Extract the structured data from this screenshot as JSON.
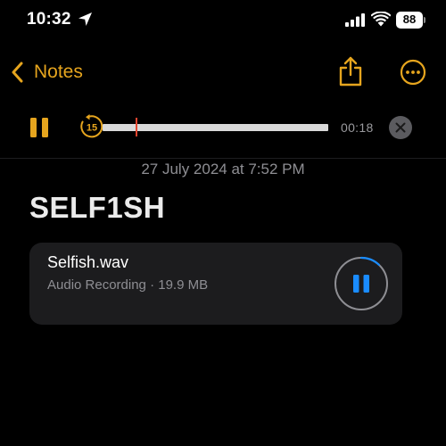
{
  "status_bar": {
    "time": "10:32",
    "battery": "88",
    "icons": [
      "location-arrow-icon",
      "cellular-signal-icon",
      "wifi-icon",
      "battery-icon"
    ]
  },
  "nav": {
    "back_label": "Notes",
    "icons": [
      "chevron-left-icon",
      "share-icon",
      "more-icon"
    ]
  },
  "player": {
    "elapsed": "00:18",
    "progress": 0.15,
    "skip_back_seconds": "15",
    "state": "playing"
  },
  "note": {
    "date": "27 July 2024 at 7:52 PM",
    "title": "SELF1SH"
  },
  "attachment": {
    "file_name": "Selfish.wav",
    "meta": "Audio Recording · 19.9 MB",
    "playback_progress": 0.12,
    "state": "playing"
  },
  "colors": {
    "accent": "#e6a51e",
    "background": "#000000",
    "card": "#1c1c1e",
    "secondary_text": "#8e8e93",
    "playhead": "#e3452f",
    "play_blue": "#1a8cff"
  }
}
